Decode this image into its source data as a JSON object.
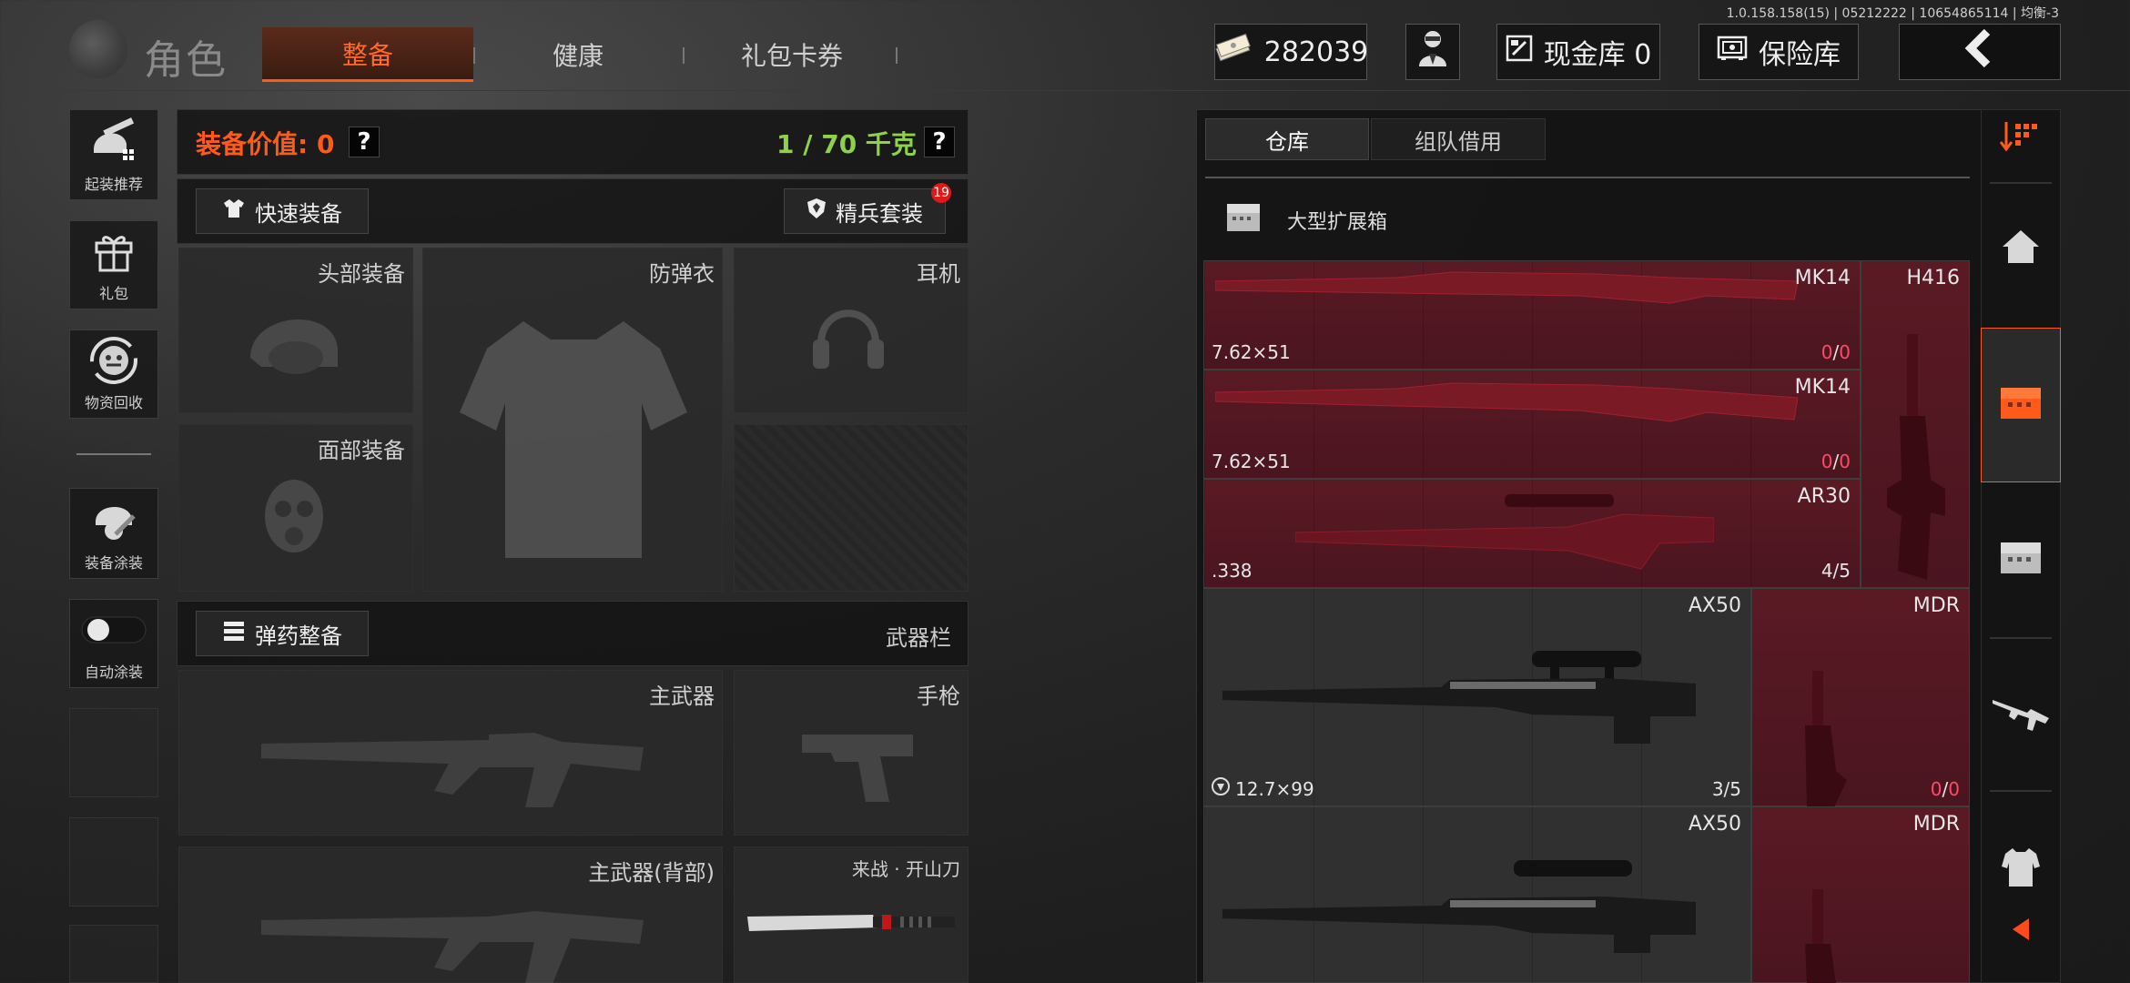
{
  "version_text": "1.0.158.158(15) | 05212222 | 10654865114 | 均衡-3",
  "header": {
    "title": "角色",
    "tabs": [
      {
        "label": "整备",
        "active": true
      },
      {
        "label": "健康",
        "active": false
      },
      {
        "label": "礼包卡券",
        "active": false
      }
    ],
    "currency_value": "282039",
    "cash_vault_label": "现金库 0",
    "safe_label": "保险库"
  },
  "sidebar": {
    "items": [
      {
        "label": "起装推荐",
        "icon": "helmet-gun-icon"
      },
      {
        "label": "礼包",
        "icon": "gift-icon"
      },
      {
        "label": "物资回收",
        "icon": "recycle-face-icon"
      },
      {
        "label": "装备涂装",
        "icon": "helmet-paint-icon"
      },
      {
        "label": "自动涂装",
        "icon": "toggle-icon"
      }
    ]
  },
  "loadout": {
    "value_label": "装备价值: 0",
    "weight_label": "1 / 70 千克",
    "quick_equip_label": "快速装备",
    "elite_set_label": "精兵套装",
    "elite_badge": "19",
    "ammo_button_label": "弹药整备",
    "weapon_bar_label": "武器栏",
    "slots": {
      "head": "头部装备",
      "armor": "防弹衣",
      "headset": "耳机",
      "face": "面部装备",
      "primary": "主武器",
      "pistol": "手枪",
      "primary_back": "主武器(背部)",
      "melee": "来战 · 开山刀"
    }
  },
  "warehouse": {
    "tabs": [
      {
        "label": "仓库",
        "active": true
      },
      {
        "label": "组队借用",
        "active": false
      }
    ],
    "container_label": "大型扩展箱",
    "items": [
      {
        "name": "MK14",
        "ammo": "7.62×51",
        "count_a": "0",
        "count_b": "0",
        "color": "red"
      },
      {
        "name": "MK14",
        "ammo": "7.62×51",
        "count_a": "0",
        "count_b": "0",
        "color": "red"
      },
      {
        "name": "AR30",
        "ammo": ".338",
        "count": "4/5",
        "color": "red"
      },
      {
        "name": "AX50",
        "ammo": "12.7×99",
        "count": "3/5",
        "color": "grey"
      },
      {
        "name": "AX50",
        "ammo": "",
        "count": "",
        "color": "grey"
      },
      {
        "name": "H416",
        "ammo": "",
        "count": "",
        "color": "red"
      },
      {
        "name": "MDR",
        "ammo": "",
        "count_a": "0",
        "count_b": "0",
        "color": "red"
      },
      {
        "name": "MDR",
        "ammo": "",
        "count": "",
        "color": "red"
      }
    ]
  },
  "right_nav": [
    "sort-icon",
    "home-icon",
    "large-box-icon",
    "box-icon",
    "rifle-icon",
    "vest-icon",
    "collapse-arrow-icon"
  ],
  "colors": {
    "accent": "#ff5a1a",
    "weight_green": "#8fd14a",
    "value_orange": "#ff5a1a",
    "item_red": "#5a1a24"
  }
}
